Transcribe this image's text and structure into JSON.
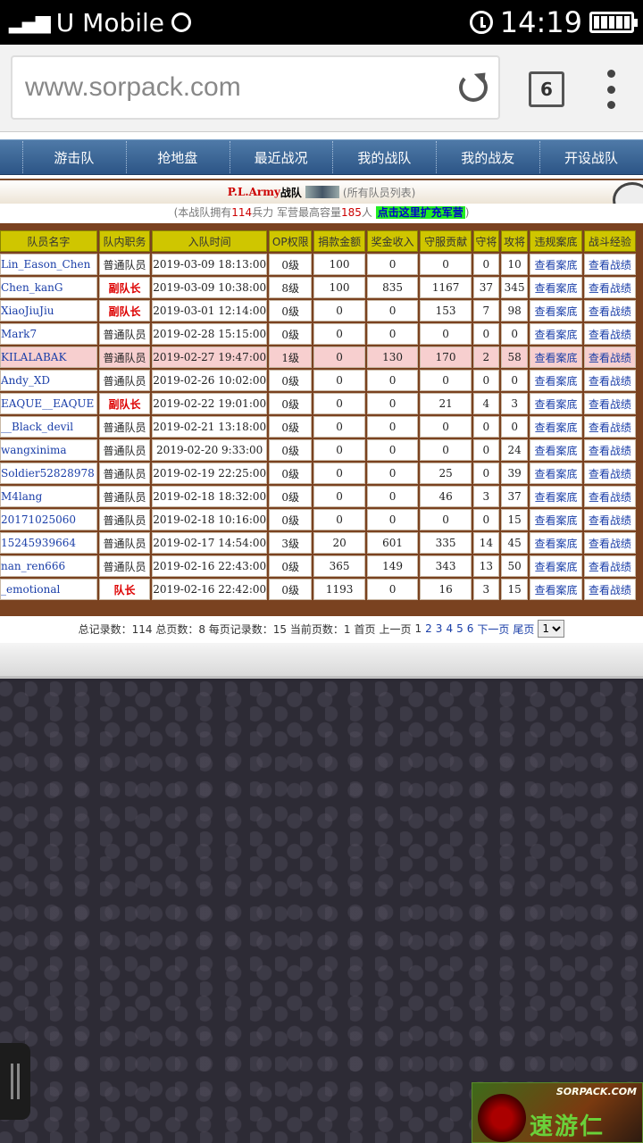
{
  "statusbar": {
    "carrier": "U Mobile",
    "time": "14:19",
    "signal_icon": "signal-icon",
    "battery_icon": "battery-icon"
  },
  "browser": {
    "url": "www.sorpack.com",
    "tab_count": "6"
  },
  "nav": {
    "items": [
      "游击队",
      "抢地盘",
      "最近战况",
      "我的战队",
      "我的战友",
      "开设战队"
    ]
  },
  "team": {
    "name": "P.L.Army",
    "suffix": "战队",
    "note": "(所有队员列表)",
    "info_prefix": "(本战队拥有",
    "soldiers": "114",
    "info_mid": "兵力 军营最高容量",
    "capacity": "185",
    "info_unit": "人",
    "expand_label": "点击这里扩充军营",
    "info_suffix": ")"
  },
  "table": {
    "headers": [
      "队员名字",
      "队内职务",
      "入队时间",
      "OP权限",
      "捐款金额",
      "奖金收入",
      "守服贡献",
      "守将",
      "攻将",
      "违规案底",
      "战斗经验"
    ],
    "rows": [
      {
        "name": "Lin_Eason_Chen",
        "role": "普通队员",
        "time": "2019-03-09 18:13:00",
        "op": "0级",
        "donate": "100",
        "bonus": "0",
        "guard": "0",
        "def": "0",
        "atk": "10",
        "violation": "查看案底",
        "record": "查看战绩"
      },
      {
        "name": "Chen_kanG",
        "role": "副队长",
        "time": "2019-03-09 10:38:00",
        "op": "8级",
        "donate": "100",
        "bonus": "835",
        "guard": "1167",
        "def": "37",
        "atk": "345",
        "violation": "查看案底",
        "record": "查看战绩"
      },
      {
        "name": "XiaoJiuJiu",
        "role": "副队长",
        "time": "2019-03-01 12:14:00",
        "op": "0级",
        "donate": "0",
        "bonus": "0",
        "guard": "153",
        "def": "7",
        "atk": "98",
        "violation": "查看案底",
        "record": "查看战绩"
      },
      {
        "name": "Mark7",
        "role": "普通队员",
        "time": "2019-02-28 15:15:00",
        "op": "0级",
        "donate": "0",
        "bonus": "0",
        "guard": "0",
        "def": "0",
        "atk": "0",
        "violation": "查看案底",
        "record": "查看战绩"
      },
      {
        "name": "KILALABAK",
        "role": "普通队员",
        "time": "2019-02-27 19:47:00",
        "op": "1级",
        "donate": "0",
        "bonus": "130",
        "guard": "170",
        "def": "2",
        "atk": "58",
        "violation": "查看案底",
        "record": "查看战绩"
      },
      {
        "name": "Andy_XD",
        "role": "普通队员",
        "time": "2019-02-26 10:02:00",
        "op": "0级",
        "donate": "0",
        "bonus": "0",
        "guard": "0",
        "def": "0",
        "atk": "0",
        "violation": "查看案底",
        "record": "查看战绩"
      },
      {
        "name": "EAQUE__EAQUE",
        "role": "副队长",
        "time": "2019-02-22 19:01:00",
        "op": "0级",
        "donate": "0",
        "bonus": "0",
        "guard": "21",
        "def": "4",
        "atk": "3",
        "violation": "查看案底",
        "record": "查看战绩"
      },
      {
        "name": "Black_devil__",
        "role": "普通队员",
        "time": "2019-02-21 13:18:00",
        "op": "0级",
        "donate": "0",
        "bonus": "0",
        "guard": "0",
        "def": "0",
        "atk": "0",
        "violation": "查看案底",
        "record": "查看战绩"
      },
      {
        "name": "wangxinima",
        "role": "普通队员",
        "time": "2019-02-20 9:33:00",
        "op": "0级",
        "donate": "0",
        "bonus": "0",
        "guard": "0",
        "def": "0",
        "atk": "24",
        "violation": "查看案底",
        "record": "查看战绩"
      },
      {
        "name": "Soldier52828978",
        "role": "普通队员",
        "time": "2019-02-19 22:25:00",
        "op": "0级",
        "donate": "0",
        "bonus": "0",
        "guard": "25",
        "def": "0",
        "atk": "39",
        "violation": "查看案底",
        "record": "查看战绩"
      },
      {
        "name": "M4lang",
        "role": "普通队员",
        "time": "2019-02-18 18:32:00",
        "op": "0级",
        "donate": "0",
        "bonus": "0",
        "guard": "46",
        "def": "3",
        "atk": "37",
        "violation": "查看案底",
        "record": "查看战绩"
      },
      {
        "name": "20171025060",
        "role": "普通队员",
        "time": "2019-02-18 10:16:00",
        "op": "0级",
        "donate": "0",
        "bonus": "0",
        "guard": "0",
        "def": "0",
        "atk": "15",
        "violation": "查看案底",
        "record": "查看战绩"
      },
      {
        "name": "15245939664",
        "role": "普通队员",
        "time": "2019-02-17 14:54:00",
        "op": "3级",
        "donate": "20",
        "bonus": "601",
        "guard": "335",
        "def": "14",
        "atk": "45",
        "violation": "查看案底",
        "record": "查看战绩"
      },
      {
        "name": "nan_ren666",
        "role": "普通队员",
        "time": "2019-02-16 22:43:00",
        "op": "0级",
        "donate": "365",
        "bonus": "149",
        "guard": "343",
        "def": "13",
        "atk": "50",
        "violation": "查看案底",
        "record": "查看战绩"
      },
      {
        "name": "emotional_",
        "role": "队长",
        "time": "2019-02-16 22:42:00",
        "op": "0级",
        "donate": "1193",
        "bonus": "0",
        "guard": "16",
        "def": "3",
        "atk": "15",
        "violation": "查看案底",
        "record": "查看战绩"
      }
    ]
  },
  "pager": {
    "summary": "总记录数：114 总页数：8 每页记录数：15 当前页数：1",
    "first": "首页",
    "prev": "上一页",
    "current": "1",
    "pages": [
      "2",
      "3",
      "4",
      "5",
      "6"
    ],
    "next": "下一页",
    "last": "尾页",
    "select_value": "1"
  },
  "watermark": {
    "url": "SORPACK.COM",
    "text": "速游仁"
  }
}
